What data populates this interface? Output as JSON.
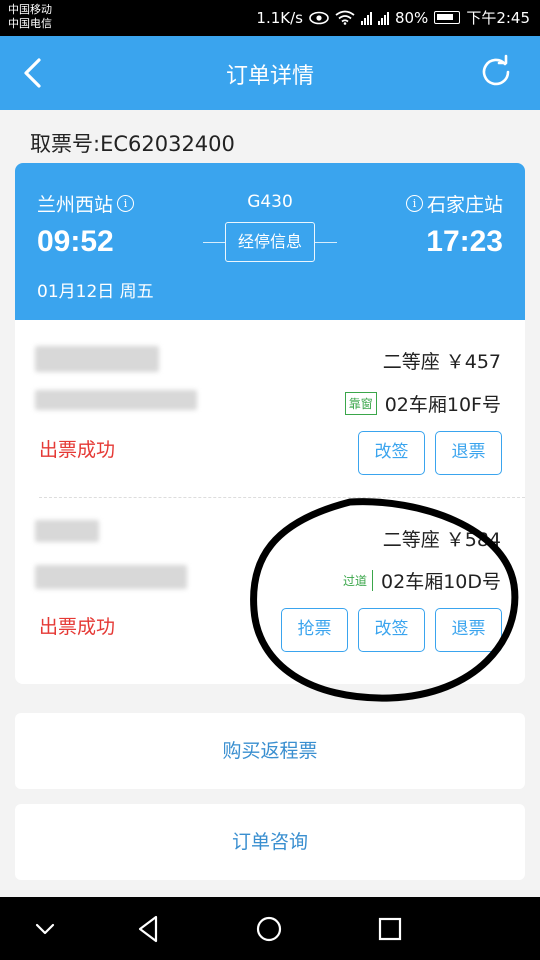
{
  "status_bar": {
    "carrier_1": "中国移动",
    "carrier_2": "中国电信",
    "speed": "1.1K/s",
    "battery": "80%",
    "time": "下午2:45"
  },
  "header": {
    "title": "订单详情",
    "back_icon": "chevron-left-icon",
    "refresh_icon": "refresh-icon",
    "color": "#3aa4ee"
  },
  "ticket_number": "取票号:EC62032400",
  "train": {
    "from_station": "兰州西站",
    "to_station": "石家庄站",
    "train_no": "G430",
    "depart_time": "09:52",
    "arrive_time": "17:23",
    "stops_label": "经停信息",
    "date": "01月12日  周五"
  },
  "passengers": [
    {
      "seat_class": "二等座 ￥457",
      "seat_tag": "靠窗",
      "seat": "02车厢10F号",
      "status": "出票成功",
      "buttons": [
        "改签",
        "退票"
      ]
    },
    {
      "seat_class": "二等座 ￥584",
      "seat_tag": "过道",
      "seat": "02车厢10D号",
      "status": "出票成功",
      "buttons": [
        "抢票",
        "改签",
        "退票"
      ]
    }
  ],
  "actions": {
    "return_ticket": "购买返程票",
    "consult": "订单咨询"
  },
  "colors": {
    "accent": "#3aa4ee",
    "success_red": "#e53935",
    "window_green": "#3aa64a"
  }
}
